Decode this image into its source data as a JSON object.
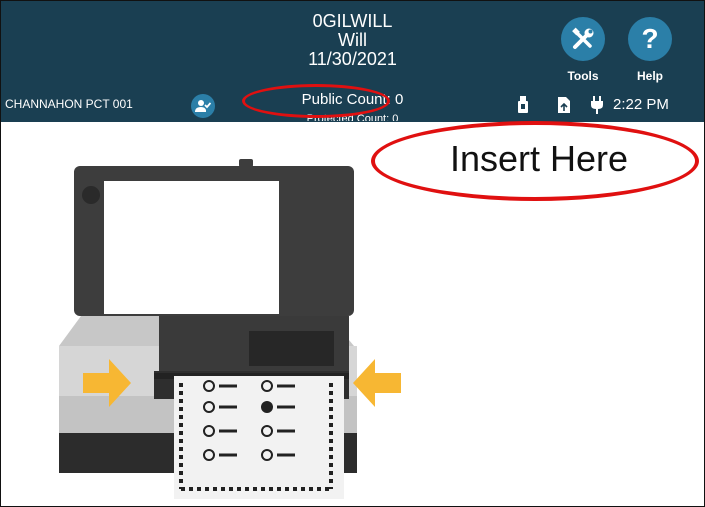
{
  "header": {
    "line1": "0GILWILL",
    "line2": "Will",
    "line3": "11/30/2021",
    "precinct": "CHANNAHON PCT 001",
    "public_count": "Public Count: 0",
    "protected_count": "Protected Count: 0",
    "tools_label": "Tools",
    "help_label": "Help",
    "help_glyph": "?",
    "time": "2:22 PM"
  },
  "main": {
    "instruction": "Insert Here"
  },
  "icons": [
    "user-check-icon",
    "tools-icon",
    "help-icon",
    "usb-icon",
    "report-icon",
    "power-plug-icon",
    "scanner-illustration"
  ],
  "colors": {
    "header_bg": "#1a3f52",
    "button_bg": "#2b7fa8",
    "highlight_red": "#e01010",
    "arrow_yellow": "#f7b733"
  }
}
